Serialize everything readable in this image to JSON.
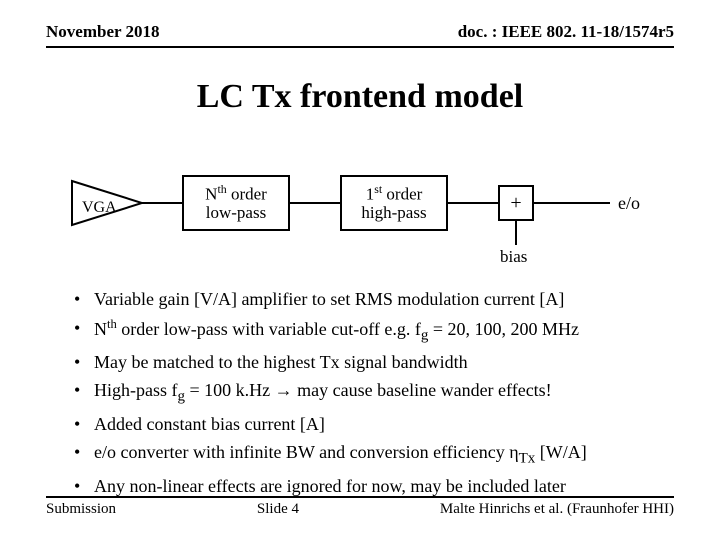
{
  "header": {
    "left": "November 2018",
    "right": "doc. : IEEE 802. 11-18/1574r5"
  },
  "title": "LC Tx frontend model",
  "diagram": {
    "vga": "VGA",
    "lowpass_line1_html": "N<sup>th</sup> order",
    "lowpass_line2": "low-pass",
    "highpass_line1_html": "1<sup>st</sup> order",
    "highpass_line2": "high-pass",
    "sum": "+",
    "eo": "e/o",
    "bias": "bias"
  },
  "bullets": [
    "Variable gain [V/A] amplifier to set RMS modulation current [A]",
    "N<sup>th</sup> order low-pass with variable cut-off e.g. f<sub>g</sub> = 20, 100, 200 MHz",
    "May be matched to the highest Tx signal bandwidth",
    "High-pass f<sub>g</sub> = 100 k.Hz → may cause baseline wander effects!",
    "Added constant bias current [A]",
    "e/o converter with infinite BW and conversion efficiency η<sub>Tx</sub> [W/A]",
    "Any non-linear effects are ignored for now, may be included later"
  ],
  "footer": {
    "left": "Submission",
    "center": "Slide 4",
    "right": "Malte Hinrichs et al. (Fraunhofer HHI)"
  }
}
